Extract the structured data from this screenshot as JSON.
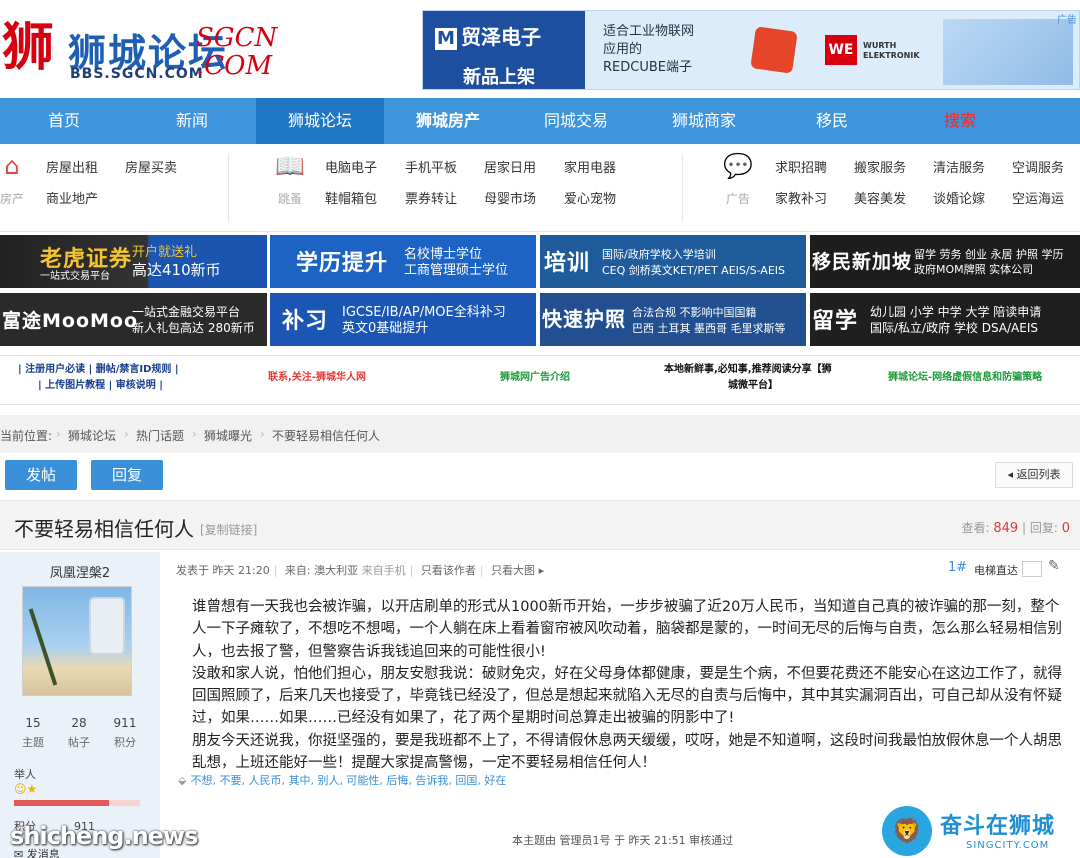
{
  "site": {
    "logo_cn": "狮城论坛",
    "logo_url": "BBS.SGCN.COM",
    "logo_script": "SGCN .COM"
  },
  "ad": {
    "brand": "贸泽电子",
    "brand_sub": "MOUSER ELECTRONICS",
    "cta": "新品上架",
    "line1": "适合工业物联网",
    "line2": "应用的",
    "line3": "REDCUBE端子",
    "partner_logo": "WE",
    "partner_name": "WURTH\nELEKTRONIK",
    "tag": "广告"
  },
  "nav": [
    "首页",
    "新闻",
    "狮城论坛",
    "狮城房产",
    "同城交易",
    "狮城商家",
    "移民",
    "搜索"
  ],
  "categories": {
    "housing": {
      "label": "房产",
      "links": [
        "房屋出租",
        "房屋买卖",
        "商业地产"
      ]
    },
    "market": {
      "label": "跳蚤",
      "links": [
        "电脑电子",
        "手机平板",
        "居家日用",
        "家用电器",
        "鞋帽箱包",
        "票券转让",
        "母婴市场",
        "爱心宠物"
      ]
    },
    "ads": {
      "label": "广告",
      "links": [
        "求职招聘",
        "搬家服务",
        "清洁服务",
        "空调服务",
        "家教补习",
        "美容美发",
        "谈婚论嫁",
        "空运海运"
      ]
    }
  },
  "promos": [
    {
      "big": "老虎证券",
      "small1": "开户就送礼",
      "small2": "一站式交易平台",
      "small3": "高达410新币"
    },
    {
      "big": "学历提升",
      "small1": "名校博士学位",
      "small2": "工商管理硕士学位"
    },
    {
      "big": "培训",
      "small1": "国际/政府学校入学培训",
      "small2": "CEQ 剑桥英文KET/PET  AEIS/S-AEIS"
    },
    {
      "big": "移民新加坡",
      "small1": "留学 劳务 创业 永居 护照 学历",
      "small2": "政府MOM牌照 实体公司"
    },
    {
      "big": "富途MooMoo",
      "small1": "一站式金融交易平台",
      "small2": "新人礼包高达 280新币"
    },
    {
      "big": "补习",
      "small1": "IGCSE/IB/AP/MOE全科补习",
      "small2": "英文0基础提升"
    },
    {
      "big": "快速护照",
      "small1": "合法合规 不影响中国国籍",
      "small2": "巴西 土耳其 墨西哥 毛里求斯等"
    },
    {
      "big": "留学",
      "small1": "幼儿园 小学 中学 大学  陪读申请",
      "small2": "国际/私立/政府 学校  DSA/AEIS"
    }
  ],
  "notice_links": {
    "l1a": "| 注册用户必读 | 删帖/禁言ID规则 |",
    "l1b": "| 上传图片教程 | 审核说明 |",
    "l2": "联系,关注-狮城华人网",
    "l3": "狮城网广告介绍",
    "l4a": "本地新鲜事,必知事,推荐阅读分享【狮",
    "l4b": "城微平台】",
    "l5": "狮城论坛-网络虚假信息和防骗策略"
  },
  "breadcrumb": [
    "当前位置:",
    "狮城论坛",
    "热门话题",
    "狮城曝光",
    "不要轻易相信任何人"
  ],
  "buttons": {
    "post": "发帖",
    "reply": "回复",
    "back": "返回列表"
  },
  "thread": {
    "title": "不要轻易相信任何人",
    "copy_link": "[复制链接]",
    "views_label": "查看:",
    "views": "849",
    "replies_label": "| 回复:",
    "replies": "0"
  },
  "author": {
    "name": "凤凰涅槃2",
    "topics": "15",
    "topics_label": "主题",
    "posts": "28",
    "posts_label": "帖子",
    "credits": "911",
    "credits_label": "积分",
    "group": "举人",
    "credit_label": "积分",
    "credit_value": "911",
    "send_msg": "发消息"
  },
  "post": {
    "meta_posted": "发表于 昨天 21:20",
    "meta_from": "来自: 澳大利亚",
    "meta_mobile": "来自手机",
    "meta_only_author": "只看该作者",
    "meta_big_image": "只看大图",
    "floor": "1#",
    "elevator": "电梯直达",
    "paragraphs": [
      "谁曾想有一天我也会被诈骗，以开店刷单的形式从1000新币开始，一步步被骗了近20万人民币，当知道自己真的被诈骗的那一刻，整个人一下子瘫软了，不想吃不想喝，一个人躺在床上看着窗帘被风吹动着，脑袋都是蒙的，一时间无尽的后悔与自责，怎么那么轻易相信别人，也去报了警，但警察告诉我钱追回来的可能性很小!",
      "没敢和家人说，怕他们担心，朋友安慰我说：破财免灾，好在父母身体都健康，要是生个病，不但要花费还不能安心在这边工作了，就得回国照顾了，后来几天也接受了，毕竟钱已经没了，但总是想起来就陷入无尽的自责与后悔中，其中其实漏洞百出，可自己却从没有怀疑过，如果……如果……已经没有如果了，花了两个星期时间总算走出被骗的阴影中了!",
      "朋友今天还说我，你挺坚强的，要是我班都不上了，不得请假休息两天缓缓，哎呀，她是不知道啊，这段时间我最怕放假休息一个人胡思乱想，上班还能好一些！提醒大家提高警惕，一定不要轻易相信任何人！"
    ],
    "tags": "不想, 不要, 人民币, 其中, 别人, 可能性, 后悔, 告诉我, 回国, 好在",
    "audit": "本主题由 管理员1号 于 昨天 21:51 审核通过"
  },
  "watermarks": {
    "left": "shicheng.news",
    "right_cn": "奋斗在狮城",
    "right_en": "SINGCITY.COM"
  }
}
